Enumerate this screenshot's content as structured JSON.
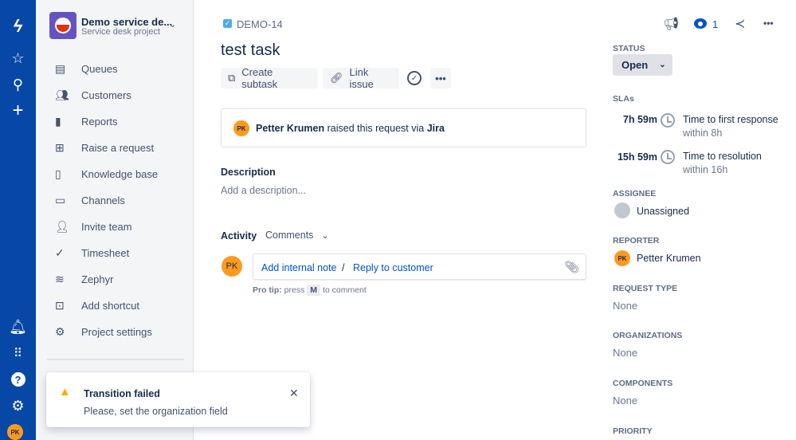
{
  "global_nav": {
    "avatar": "PK",
    "icons": [
      "atlassian-logo-icon",
      "star-icon",
      "search-icon",
      "plus-icon",
      "rocket-icon",
      "app-switcher-icon",
      "help-icon",
      "settings-icon"
    ]
  },
  "project": {
    "name": "Demo service de...",
    "type": "Service desk project"
  },
  "sidebar": {
    "items": [
      {
        "label": "Queues",
        "icon": "queues-icon"
      },
      {
        "label": "Customers",
        "icon": "customers-icon"
      },
      {
        "label": "Reports",
        "icon": "reports-icon"
      },
      {
        "label": "Raise a request",
        "icon": "raise-request-icon"
      },
      {
        "label": "Knowledge base",
        "icon": "knowledge-base-icon"
      },
      {
        "label": "Channels",
        "icon": "channels-icon"
      },
      {
        "label": "Invite team",
        "icon": "invite-team-icon"
      },
      {
        "label": "Timesheet",
        "icon": "timesheet-icon"
      },
      {
        "label": "Zephyr",
        "icon": "zephyr-icon"
      },
      {
        "label": "Add shortcut",
        "icon": "add-shortcut-icon"
      },
      {
        "label": "Project settings",
        "icon": "gear-icon"
      }
    ]
  },
  "toast": {
    "title": "Transition failed",
    "message": "Please, set the organization field"
  },
  "issue": {
    "key": "DEMO-14",
    "title": "test task",
    "create_subtask": "Create subtask",
    "link_issue": "Link issue",
    "requester_avatar": "PK",
    "requester": "Petter Krumen",
    "raised_text": "raised this request via",
    "channel": "Jira",
    "description_label": "Description",
    "description_placeholder": "Add a description...",
    "activity_label": "Activity",
    "activity_filter": "Comments",
    "commenter_avatar": "PK",
    "add_internal_note": "Add internal note",
    "separator": "/",
    "reply_to_customer": "Reply to customer",
    "pro_tip_label": "Pro tip:",
    "pro_tip_press": "press",
    "pro_tip_key": "M",
    "pro_tip_rest": "to comment"
  },
  "header_actions": {
    "watchers": "1"
  },
  "details": {
    "status_label": "STATUS",
    "status": "Open",
    "slas_label": "SLAs",
    "slas": [
      {
        "remaining": "7h 59m",
        "name": "Time to first response",
        "goal": "within 8h"
      },
      {
        "remaining": "15h 59m",
        "name": "Time to resolution",
        "goal": "within 16h"
      }
    ],
    "assignee_label": "ASSIGNEE",
    "assignee": "Unassigned",
    "reporter_label": "REPORTER",
    "reporter_avatar": "PK",
    "reporter": "Petter Krumen",
    "request_type_label": "REQUEST TYPE",
    "request_type": "None",
    "organizations_label": "ORGANIZATIONS",
    "organizations": "None",
    "components_label": "COMPONENTS",
    "components": "None",
    "priority_label": "PRIORITY"
  },
  "colors": {
    "nav": "#0747a6",
    "link": "#0052cc",
    "avatar": "#ff991f",
    "warning": "#ffab00"
  }
}
